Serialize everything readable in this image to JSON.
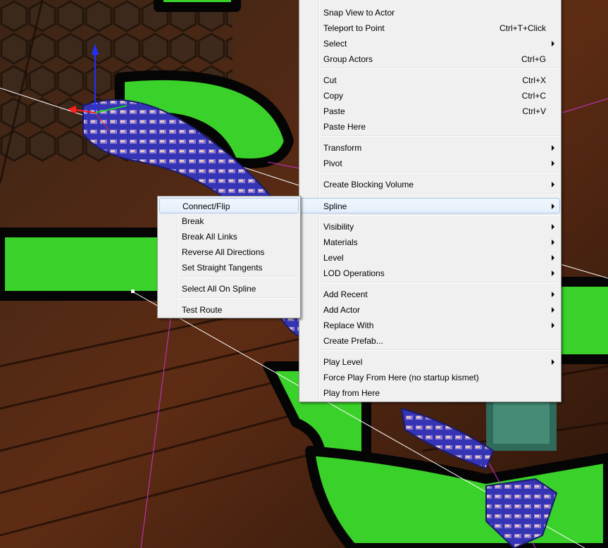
{
  "main_menu": {
    "items": [
      {
        "label": "Snap View to Actor",
        "shortcut": "",
        "submenu": false
      },
      {
        "label": "Teleport to Point",
        "shortcut": "Ctrl+T+Click",
        "submenu": false
      },
      {
        "label": "Select",
        "shortcut": "",
        "submenu": true
      },
      {
        "label": "Group Actors",
        "shortcut": "Ctrl+G",
        "submenu": false
      },
      {
        "label": "Cut",
        "shortcut": "Ctrl+X",
        "submenu": false
      },
      {
        "label": "Copy",
        "shortcut": "Ctrl+C",
        "submenu": false
      },
      {
        "label": "Paste",
        "shortcut": "Ctrl+V",
        "submenu": false
      },
      {
        "label": "Paste Here",
        "shortcut": "",
        "submenu": false
      },
      {
        "label": "Transform",
        "shortcut": "",
        "submenu": true
      },
      {
        "label": "Pivot",
        "shortcut": "",
        "submenu": true
      },
      {
        "label": "Create Blocking Volume",
        "shortcut": "",
        "submenu": true
      },
      {
        "label": "Spline",
        "shortcut": "",
        "submenu": true
      },
      {
        "label": "Visibility",
        "shortcut": "",
        "submenu": true
      },
      {
        "label": "Materials",
        "shortcut": "",
        "submenu": true
      },
      {
        "label": "Level",
        "shortcut": "",
        "submenu": true
      },
      {
        "label": "LOD Operations",
        "shortcut": "",
        "submenu": true
      },
      {
        "label": "Add Recent",
        "shortcut": "",
        "submenu": true
      },
      {
        "label": "Add Actor",
        "shortcut": "",
        "submenu": true
      },
      {
        "label": "Replace With",
        "shortcut": "",
        "submenu": true
      },
      {
        "label": "Create Prefab...",
        "shortcut": "",
        "submenu": false
      },
      {
        "label": "Play Level",
        "shortcut": "",
        "submenu": true
      },
      {
        "label": "Force Play From Here (no startup kismet)",
        "shortcut": "",
        "submenu": false
      },
      {
        "label": "Play from Here",
        "shortcut": "",
        "submenu": false
      }
    ]
  },
  "spline_submenu": {
    "items": [
      {
        "label": "Connect/Flip"
      },
      {
        "label": "Break"
      },
      {
        "label": "Break All Links"
      },
      {
        "label": "Reverse All Directions"
      },
      {
        "label": "Set Straight Tangents"
      },
      {
        "label": "Select All On Spline"
      },
      {
        "label": "Test Route"
      }
    ]
  },
  "colors": {
    "menu_background": "#f0f0f0",
    "highlight_border": "#a8c8ef",
    "gizmo_green": "#3ad12a",
    "spline_mesh": "#3a3ac8",
    "background_wood": "#5a2a14"
  }
}
